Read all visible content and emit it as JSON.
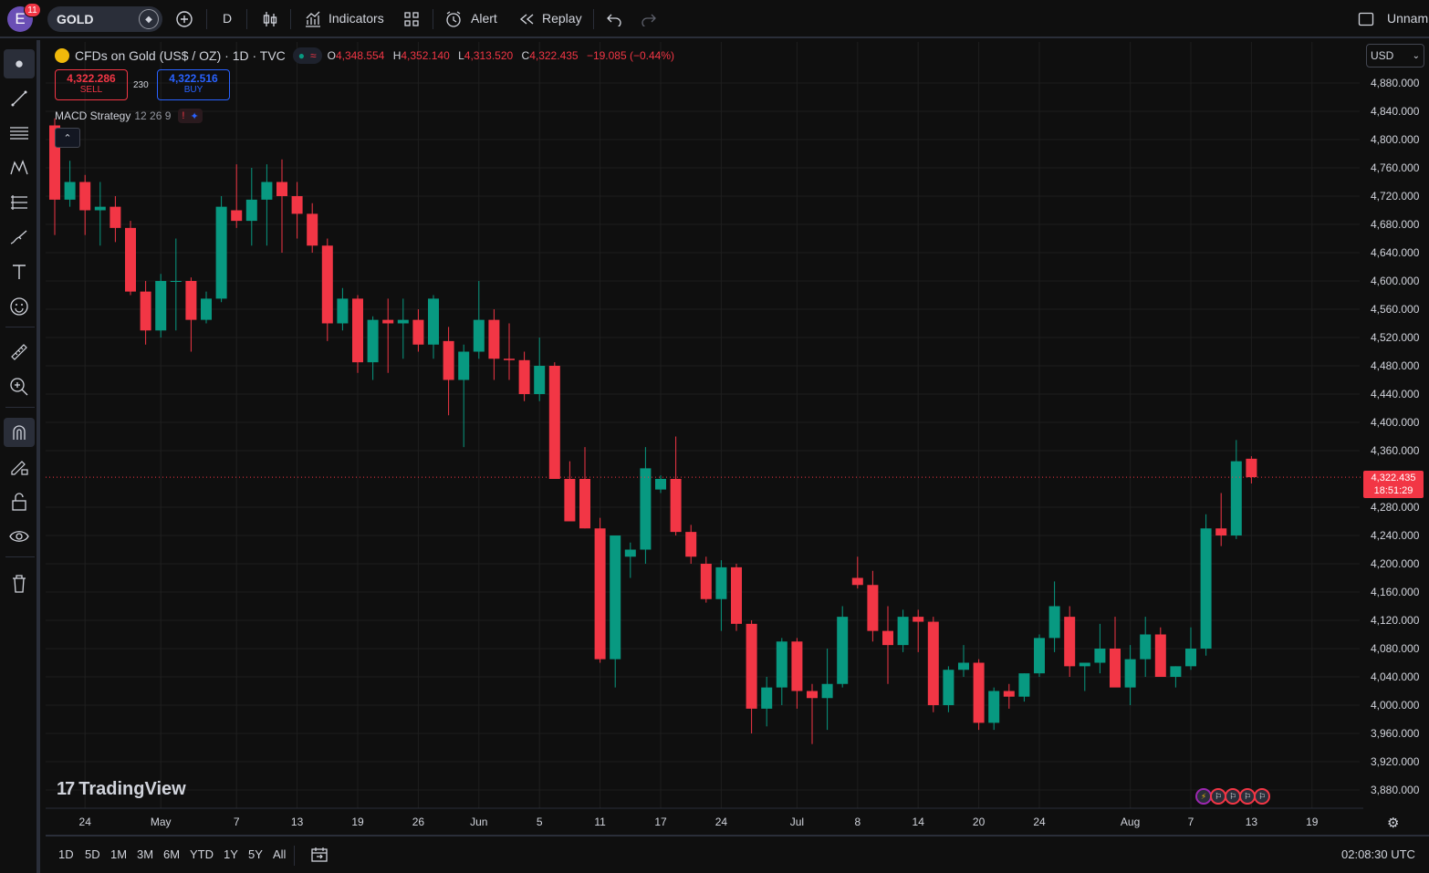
{
  "topbar": {
    "avatar_letter": "E",
    "notif_count": "11",
    "symbol": "GOLD",
    "interval": "D",
    "indicators_label": "Indicators",
    "alert_label": "Alert",
    "replay_label": "Replay",
    "layout_name": "Unnam"
  },
  "legend": {
    "title": "CFDs on Gold (US$ / OZ) · 1D · TVC",
    "o_key": "O",
    "o_val": "4,348.554",
    "h_key": "H",
    "h_val": "4,352.140",
    "l_key": "L",
    "l_val": "4,313.520",
    "c_key": "C",
    "c_val": "4,322.435",
    "change": "−19.085 (−0.44%)"
  },
  "trade": {
    "sell_price": "4,322.286",
    "sell_label": "SELL",
    "spread": "230",
    "buy_price": "4,322.516",
    "buy_label": "BUY"
  },
  "strategy": {
    "name": "MACD Strategy",
    "params": "12 26 9"
  },
  "currency": "USD",
  "last_price": {
    "price": "4,322.435",
    "countdown": "18:51:29"
  },
  "brand": "TradingView",
  "colors": {
    "up": "#089981",
    "down": "#f23645",
    "bg": "#0f0f0f",
    "grid": "#1e1e1e",
    "text": "#d1d4dc"
  },
  "bottombar": {
    "ranges": [
      "1D",
      "5D",
      "1M",
      "3M",
      "6M",
      "YTD",
      "1Y",
      "5Y",
      "All"
    ],
    "clock": "02:08:30 UTC"
  },
  "chart_data": {
    "type": "candlestick",
    "y_ticks": [
      3880,
      3920,
      3960,
      4000,
      4040,
      4080,
      4120,
      4160,
      4200,
      4240,
      4280,
      4360,
      4400,
      4440,
      4480,
      4520,
      4560,
      4600,
      4640,
      4680,
      4720,
      4760,
      4800,
      4840,
      4880
    ],
    "y_tick_labels": [
      "3,880.000",
      "3,920.000",
      "3,960.000",
      "4,000.000",
      "4,040.000",
      "4,080.000",
      "4,120.000",
      "4,160.000",
      "4,200.000",
      "4,240.000",
      "4,280.000",
      "4,360.000",
      "4,400.000",
      "4,440.000",
      "4,480.000",
      "4,520.000",
      "4,560.000",
      "4,600.000",
      "4,640.000",
      "4,680.000",
      "4,720.000",
      "4,760.000",
      "4,800.000",
      "4,840.000",
      "4,880.000"
    ],
    "x_labels": [
      {
        "label": "24",
        "index": 2
      },
      {
        "label": "May",
        "index": 7
      },
      {
        "label": "7",
        "index": 12
      },
      {
        "label": "13",
        "index": 16
      },
      {
        "label": "19",
        "index": 20
      },
      {
        "label": "26",
        "index": 24
      },
      {
        "label": "Jun",
        "index": 28
      },
      {
        "label": "5",
        "index": 32
      },
      {
        "label": "11",
        "index": 36
      },
      {
        "label": "17",
        "index": 40
      },
      {
        "label": "24",
        "index": 44
      },
      {
        "label": "Jul",
        "index": 49
      },
      {
        "label": "8",
        "index": 53
      },
      {
        "label": "14",
        "index": 57
      },
      {
        "label": "20",
        "index": 61
      },
      {
        "label": "24",
        "index": 65
      },
      {
        "label": "Aug",
        "index": 71
      },
      {
        "label": "7",
        "index": 75
      },
      {
        "label": "13",
        "index": 79
      },
      {
        "label": "19",
        "index": 83
      }
    ],
    "last_price": 4322.435,
    "candles": [
      [
        4820,
        4830,
        4665,
        4715
      ],
      [
        4715,
        4770,
        4705,
        4740
      ],
      [
        4740,
        4750,
        4665,
        4700
      ],
      [
        4700,
        4740,
        4650,
        4705
      ],
      [
        4705,
        4720,
        4655,
        4675
      ],
      [
        4675,
        4685,
        4580,
        4585
      ],
      [
        4585,
        4600,
        4510,
        4530
      ],
      [
        4530,
        4610,
        4520,
        4600
      ],
      [
        4600,
        4660,
        4530,
        4600
      ],
      [
        4600,
        4605,
        4500,
        4545
      ],
      [
        4545,
        4585,
        4540,
        4575
      ],
      [
        4575,
        4720,
        4570,
        4705
      ],
      [
        4700,
        4765,
        4675,
        4685
      ],
      [
        4685,
        4760,
        4650,
        4715
      ],
      [
        4715,
        4765,
        4650,
        4740
      ],
      [
        4740,
        4772,
        4640,
        4720
      ],
      [
        4720,
        4740,
        4660,
        4695
      ],
      [
        4695,
        4710,
        4640,
        4650
      ],
      [
        4650,
        4660,
        4515,
        4540
      ],
      [
        4540,
        4590,
        4530,
        4575
      ],
      [
        4575,
        4580,
        4470,
        4485
      ],
      [
        4485,
        4550,
        4460,
        4545
      ],
      [
        4545,
        4575,
        4470,
        4540
      ],
      [
        4540,
        4575,
        4490,
        4545
      ],
      [
        4545,
        4560,
        4500,
        4510
      ],
      [
        4510,
        4580,
        4490,
        4575
      ],
      [
        4515,
        4535,
        4410,
        4460
      ],
      [
        4460,
        4510,
        4365,
        4500
      ],
      [
        4500,
        4600,
        4490,
        4545
      ],
      [
        4545,
        4560,
        4460,
        4490
      ],
      [
        4490,
        4540,
        4460,
        4488
      ],
      [
        4488,
        4500,
        4430,
        4440
      ],
      [
        4440,
        4520,
        4430,
        4480
      ],
      [
        4480,
        4485,
        4320,
        4320
      ],
      [
        4320,
        4345,
        4270,
        4260
      ],
      [
        4320,
        4365,
        4250,
        4250
      ],
      [
        4250,
        4265,
        4060,
        4065
      ],
      [
        4065,
        4225,
        4025,
        4240
      ],
      [
        4210,
        4230,
        4180,
        4220
      ],
      [
        4220,
        4365,
        4200,
        4335
      ],
      [
        4305,
        4325,
        4300,
        4320
      ],
      [
        4320,
        4380,
        4240,
        4245
      ],
      [
        4245,
        4255,
        4200,
        4210
      ],
      [
        4200,
        4210,
        4145,
        4150
      ],
      [
        4150,
        4205,
        4105,
        4195
      ],
      [
        4195,
        4200,
        4105,
        4115
      ],
      [
        4115,
        4120,
        3960,
        3995
      ],
      [
        3995,
        4040,
        3970,
        4025
      ],
      [
        4025,
        4095,
        4000,
        4090
      ],
      [
        4090,
        4095,
        3995,
        4020
      ],
      [
        4020,
        4030,
        3945,
        4010
      ],
      [
        4010,
        4080,
        3965,
        4030
      ],
      [
        4030,
        4140,
        4025,
        4125
      ],
      [
        4180,
        4210,
        4165,
        4170
      ],
      [
        4170,
        4190,
        4090,
        4105
      ],
      [
        4105,
        4140,
        4030,
        4085
      ],
      [
        4085,
        4135,
        4075,
        4125
      ],
      [
        4125,
        4135,
        4075,
        4118
      ],
      [
        4118,
        4125,
        3990,
        4000
      ],
      [
        4000,
        4055,
        3990,
        4050
      ],
      [
        4050,
        4085,
        4040,
        4060
      ],
      [
        4060,
        4065,
        3965,
        3975
      ],
      [
        3975,
        4025,
        3965,
        4020
      ],
      [
        4020,
        4030,
        3995,
        4012
      ],
      [
        4012,
        4045,
        4005,
        4045
      ],
      [
        4045,
        4100,
        4040,
        4095
      ],
      [
        4095,
        4175,
        4075,
        4140
      ],
      [
        4125,
        4140,
        4040,
        4055
      ],
      [
        4055,
        4060,
        4020,
        4060
      ],
      [
        4060,
        4115,
        4045,
        4080
      ],
      [
        4080,
        4125,
        4030,
        4025
      ],
      [
        4025,
        4085,
        4000,
        4065
      ],
      [
        4065,
        4125,
        4040,
        4100
      ],
      [
        4100,
        4110,
        4040,
        4040
      ],
      [
        4040,
        4055,
        4025,
        4055
      ],
      [
        4055,
        4110,
        4050,
        4080
      ],
      [
        4080,
        4270,
        4070,
        4250
      ],
      [
        4250,
        4300,
        4225,
        4240
      ],
      [
        4240,
        4375,
        4235,
        4345
      ],
      [
        4348.554,
        4352.14,
        4313.52,
        4322.435
      ]
    ]
  }
}
